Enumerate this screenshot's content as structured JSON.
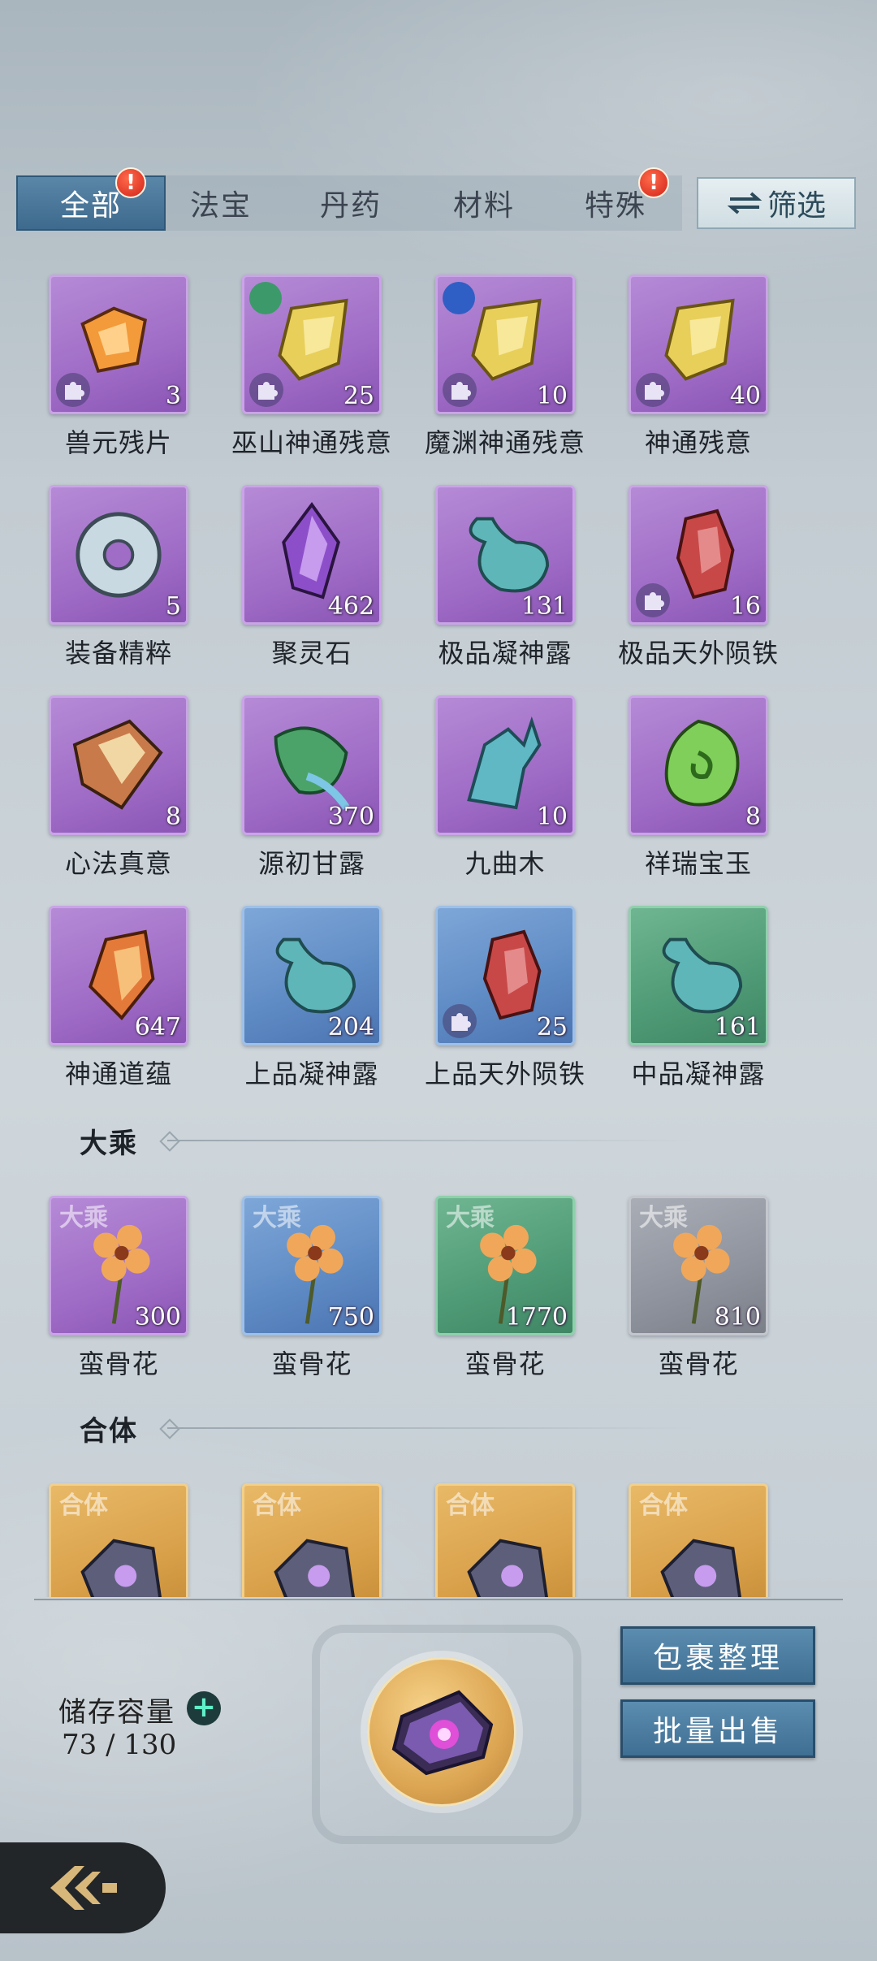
{
  "tabs": [
    {
      "label": "全部",
      "active": true,
      "badge": "!"
    },
    {
      "label": "法宝"
    },
    {
      "label": "丹药"
    },
    {
      "label": "材料"
    },
    {
      "label": "特殊",
      "badge": "!"
    }
  ],
  "filter_label": "筛选",
  "items": [
    {
      "name": "兽元残片",
      "count": "3",
      "rarity": "purple"
    },
    {
      "name": "巫山神通残意",
      "count": "25",
      "rarity": "purple"
    },
    {
      "name": "魔渊神通残意",
      "count": "10",
      "rarity": "purple"
    },
    {
      "name": "神通残意",
      "count": "40",
      "rarity": "purple"
    },
    {
      "name": "装备精粹",
      "count": "5",
      "rarity": "purple"
    },
    {
      "name": "聚灵石",
      "count": "462",
      "rarity": "purple"
    },
    {
      "name": "极品凝神露",
      "count": "131",
      "rarity": "purple"
    },
    {
      "name": "极品天外陨铁",
      "count": "16",
      "rarity": "purple"
    },
    {
      "name": "心法真意",
      "count": "8",
      "rarity": "purple"
    },
    {
      "name": "源初甘露",
      "count": "370",
      "rarity": "purple"
    },
    {
      "name": "九曲木",
      "count": "10",
      "rarity": "purple"
    },
    {
      "name": "祥瑞宝玉",
      "count": "8",
      "rarity": "purple"
    },
    {
      "name": "神通道蕴",
      "count": "647",
      "rarity": "purple"
    },
    {
      "name": "上品凝神露",
      "count": "204",
      "rarity": "blue"
    },
    {
      "name": "上品天外陨铁",
      "count": "25",
      "rarity": "blue"
    },
    {
      "name": "中品凝神露",
      "count": "161",
      "rarity": "green"
    }
  ],
  "section_dacheng": {
    "title": "大乘",
    "watermark": "大乘",
    "items": [
      {
        "name": "蛮骨花",
        "count": "300",
        "rarity": "purple"
      },
      {
        "name": "蛮骨花",
        "count": "750",
        "rarity": "blue"
      },
      {
        "name": "蛮骨花",
        "count": "1770",
        "rarity": "green"
      },
      {
        "name": "蛮骨花",
        "count": "810",
        "rarity": "gray"
      }
    ]
  },
  "section_heti": {
    "title": "合体",
    "watermark": "合体"
  },
  "storage": {
    "label": "储存容量",
    "value": "73 / 130",
    "plus": "+"
  },
  "buttons": {
    "organize": "包裹整理",
    "bulk_sell": "批量出售"
  },
  "colors": {
    "purple": "#9f6cc6",
    "blue": "#5e8ac4",
    "green": "#4f9a76",
    "gray": "#8f939d",
    "gold": "#d9a04a",
    "tab_active": "#3d6a8d"
  }
}
